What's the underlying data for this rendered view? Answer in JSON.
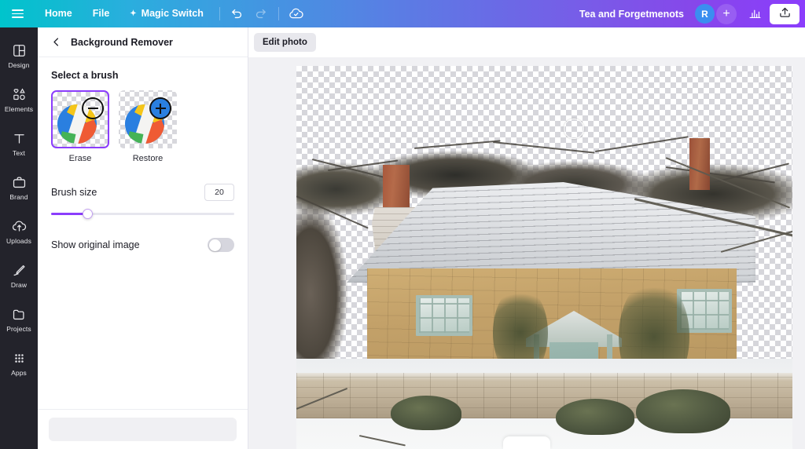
{
  "header": {
    "menu_icon": "hamburger-icon",
    "items": [
      {
        "label": "Home",
        "icon": ""
      },
      {
        "label": "File",
        "icon": ""
      },
      {
        "label": "Magic Switch",
        "icon": "sparkle-icon"
      }
    ],
    "undo_icon": "undo-icon",
    "redo_icon": "redo-icon",
    "saved_icon": "cloud-check-icon",
    "doc_title": "Tea and Forgetmenots",
    "avatar_initial": "R",
    "add_collaborator_label": "+",
    "insights_icon": "bar-chart-icon",
    "share_icon": "upload-icon",
    "gradient_start": "#00c4cc",
    "gradient_end": "#8b3dfc"
  },
  "sidebar": {
    "items": [
      {
        "label": "Design",
        "icon": "layout-icon"
      },
      {
        "label": "Elements",
        "icon": "shapes-icon"
      },
      {
        "label": "Text",
        "icon": "text-icon"
      },
      {
        "label": "Brand",
        "icon": "briefcase-icon"
      },
      {
        "label": "Uploads",
        "icon": "cloud-upload-icon"
      },
      {
        "label": "Draw",
        "icon": "pen-icon"
      },
      {
        "label": "Projects",
        "icon": "folder-icon"
      },
      {
        "label": "Apps",
        "icon": "grid-dots-icon"
      }
    ]
  },
  "panel": {
    "back_icon": "chevron-left-icon",
    "title": "Background Remover",
    "brush_section_label": "Select a brush",
    "brushes": [
      {
        "label": "Erase",
        "badge": "minus-icon",
        "selected": true
      },
      {
        "label": "Restore",
        "badge": "plus-icon",
        "selected": false
      }
    ],
    "brush_size_label": "Brush size",
    "brush_size_value": "20",
    "brush_size_percent": 20,
    "show_original_label": "Show original image",
    "show_original_on": false
  },
  "canvas": {
    "edit_photo_label": "Edit photo",
    "photo_alt": "snow-covered stone cottage with erased sky",
    "brush_cursor": "brush-cursor-circle"
  }
}
